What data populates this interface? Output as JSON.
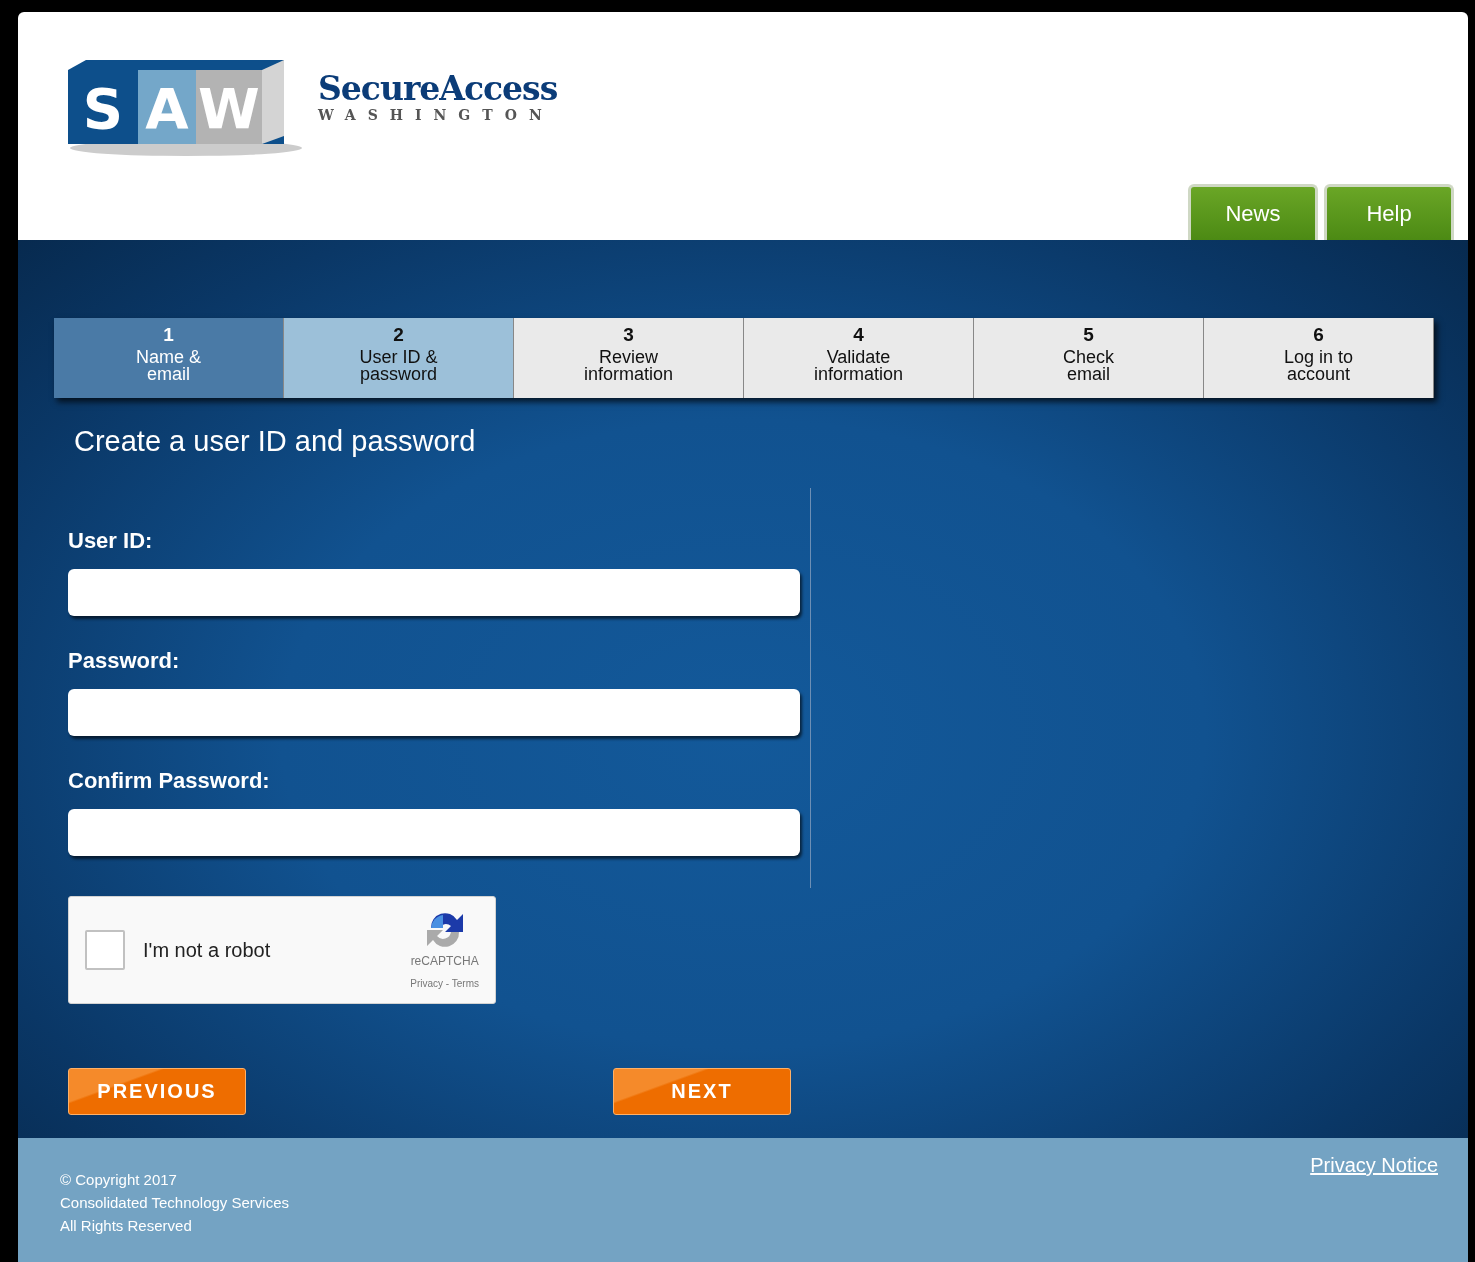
{
  "logo": {
    "letters": [
      "S",
      "A",
      "W"
    ],
    "name": "SecureAccess",
    "subtitle": "WASHINGTON"
  },
  "header_tabs": [
    {
      "label": "News"
    },
    {
      "label": "Help"
    }
  ],
  "steps": [
    {
      "number": "1",
      "label": "Name & email",
      "completed": true,
      "selected": false
    },
    {
      "number": "2",
      "label": "User ID & password",
      "completed": false,
      "selected": true
    },
    {
      "number": "3",
      "label": "Review information",
      "completed": false,
      "selected": false
    },
    {
      "number": "4",
      "label": "Validate information",
      "completed": false,
      "selected": false
    },
    {
      "number": "5",
      "label": "Check email",
      "completed": false,
      "selected": false
    },
    {
      "number": "6",
      "label": "Log in to account",
      "completed": false,
      "selected": false
    }
  ],
  "heading": "Create a user ID and password",
  "fields": [
    {
      "label": "User ID:"
    },
    {
      "label": "Password:"
    },
    {
      "label": "Confirm Password:"
    }
  ],
  "captcha": {
    "label": "I'm not a robot",
    "checked": false,
    "brand": "reCAPTCHA",
    "links": "Privacy - Terms"
  },
  "buttons": [
    {
      "label": "PREVIOUS"
    },
    {
      "label": "NEXT"
    }
  ],
  "footer": {
    "lines": [
      "© Copyright 2017",
      "Consolidated Technology Services",
      "All Rights Reserved"
    ],
    "link": "Privacy Notice"
  }
}
